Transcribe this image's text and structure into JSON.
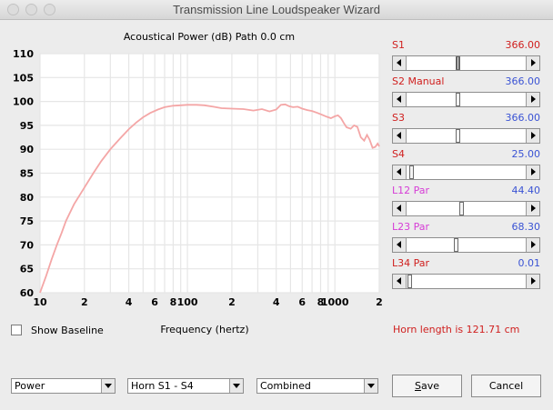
{
  "window": {
    "title": "Transmission Line Loudspeaker Wizard"
  },
  "plot": {
    "title": "Acoustical Power (dB)   Path 0.0 cm",
    "xlabel": "Frequency (hertz)"
  },
  "chart_data": {
    "type": "line",
    "title": "Acoustical Power (dB)   Path 0.0 cm",
    "xlabel": "Frequency (hertz)",
    "ylabel": "",
    "xscale": "log",
    "xlim": [
      10,
      2000
    ],
    "ylim": [
      60,
      110
    ],
    "grid": true,
    "yticks": [
      60,
      65,
      70,
      75,
      80,
      85,
      90,
      95,
      100,
      105,
      110
    ],
    "xticks": [
      {
        "value": 10,
        "label": "10"
      },
      {
        "value": 20,
        "label": "2"
      },
      {
        "value": 40,
        "label": "4"
      },
      {
        "value": 60,
        "label": "6"
      },
      {
        "value": 80,
        "label": "8"
      },
      {
        "value": 100,
        "label": "100"
      },
      {
        "value": 200,
        "label": "2"
      },
      {
        "value": 400,
        "label": "4"
      },
      {
        "value": 600,
        "label": "6"
      },
      {
        "value": 800,
        "label": "8"
      },
      {
        "value": 1000,
        "label": "1000"
      },
      {
        "value": 2000,
        "label": "2"
      }
    ],
    "series": [
      {
        "color": "#f4a6a6",
        "x": [
          10,
          11,
          12,
          13,
          14,
          15,
          17,
          20,
          23,
          26,
          30,
          35,
          40,
          45,
          50,
          56,
          63,
          70,
          80,
          90,
          100,
          115,
          130,
          150,
          170,
          200,
          240,
          280,
          320,
          360,
          400,
          430,
          460,
          490,
          520,
          560,
          600,
          650,
          700,
          760,
          820,
          880,
          940,
          1000,
          1050,
          1100,
          1150,
          1200,
          1280,
          1350,
          1420,
          1500,
          1580,
          1650,
          1720,
          1800,
          1880,
          1950,
          2000
        ],
        "y": [
          60,
          63.5,
          67,
          70,
          72.5,
          75,
          78.5,
          82,
          85,
          87.5,
          90,
          92.3,
          94.2,
          95.6,
          96.7,
          97.6,
          98.3,
          98.8,
          99.1,
          99.2,
          99.3,
          99.3,
          99.2,
          98.9,
          98.6,
          98.5,
          98.4,
          98.1,
          98.4,
          97.9,
          98.3,
          99.3,
          99.4,
          99.0,
          98.8,
          98.9,
          98.5,
          98.2,
          98.0,
          97.6,
          97.2,
          96.8,
          96.5,
          96.9,
          97.1,
          96.5,
          95.5,
          94.6,
          94.3,
          95.0,
          94.7,
          92.5,
          91.8,
          93.0,
          92.0,
          90.3,
          90.5,
          91.2,
          90.6
        ]
      }
    ]
  },
  "params": [
    {
      "label": "S1",
      "value": "366.00",
      "label_color": "#d0201f",
      "value_color": "#d0201f",
      "position": 0.43
    },
    {
      "label": "S2  Manual",
      "value": "366.00",
      "label_color": "#d0201f",
      "value_color": "#3a53d4",
      "position": 0.43
    },
    {
      "label": "S3",
      "value": "366.00",
      "label_color": "#d0201f",
      "value_color": "#3a53d4",
      "position": 0.43
    },
    {
      "label": "S4",
      "value": "25.00",
      "label_color": "#d0201f",
      "value_color": "#3a53d4",
      "position": 0.02
    },
    {
      "label": "L12  Par",
      "value": "44.40",
      "label_color": "#d63dd6",
      "value_color": "#3a53d4",
      "position": 0.46
    },
    {
      "label": "L23  Par",
      "value": "68.30",
      "label_color": "#d63dd6",
      "value_color": "#3a53d4",
      "position": 0.41
    },
    {
      "label": "L34  Par",
      "value": "0.01",
      "label_color": "#d0201f",
      "value_color": "#3a53d4",
      "position": 0.0
    }
  ],
  "horn_length": "Horn length is 121.71 cm",
  "show_baseline": {
    "label": "Show Baseline",
    "checked": false
  },
  "dropdowns": {
    "mode": "Power",
    "horn": "Horn S1 - S4",
    "combine": "Combined"
  },
  "buttons": {
    "save": "Save",
    "cancel": "Cancel"
  }
}
